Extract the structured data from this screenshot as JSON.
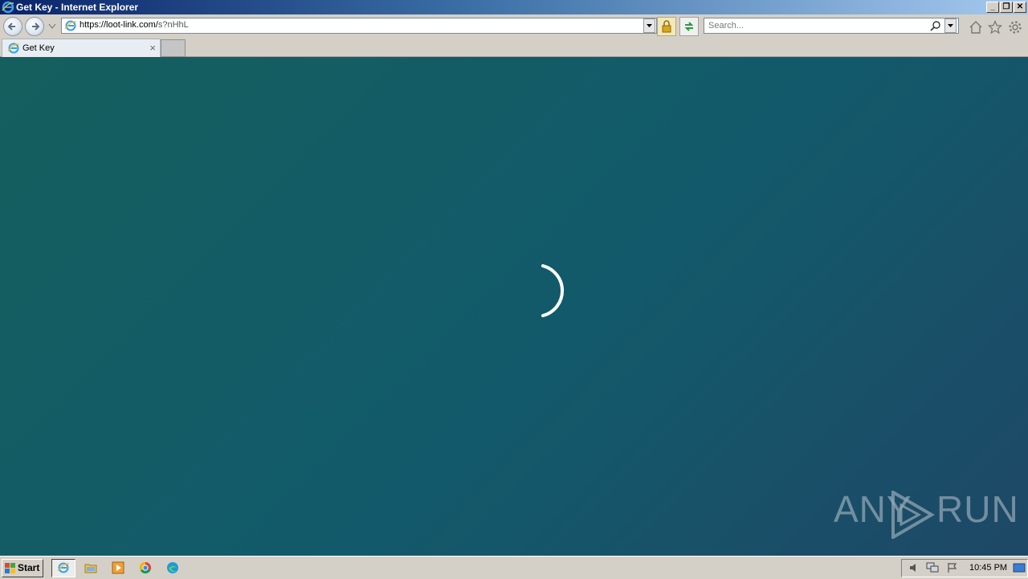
{
  "window": {
    "title": "Get Key - Internet Explorer",
    "buttons": {
      "minimize": "_",
      "restore": "❐",
      "close": "✕"
    }
  },
  "navigation": {
    "url_host": "https://loot-link.com/",
    "url_path": "s?nHhL",
    "search_placeholder": "Search..."
  },
  "tabs": [
    {
      "label": "Get Key",
      "close": "×"
    }
  ],
  "page": {
    "state": "loading",
    "background_colors": [
      "#155f5e",
      "#1e4866"
    ]
  },
  "watermark": {
    "left": "ANY",
    "right": "RUN"
  },
  "taskbar": {
    "start_label": "Start",
    "pinned": [
      "internet-explorer-icon",
      "file-explorer-icon",
      "media-player-icon",
      "chrome-icon",
      "edge-icon"
    ],
    "clock": "10:45 PM"
  }
}
